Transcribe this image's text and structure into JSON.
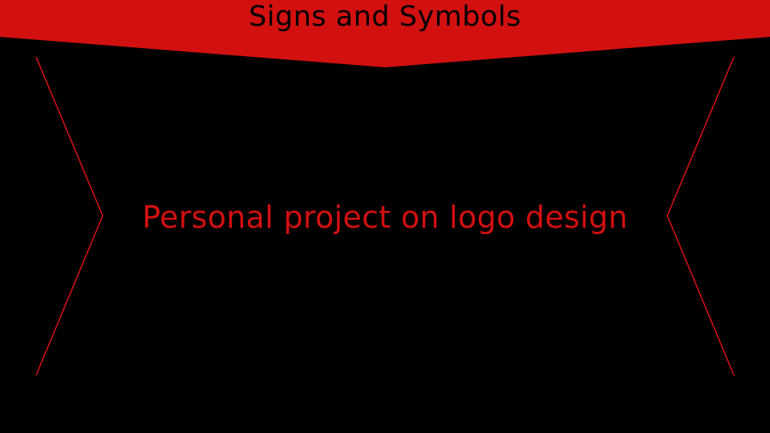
{
  "slide": {
    "title": "Signs and Symbols",
    "subtitle": "Personal project on logo design"
  },
  "colors": {
    "background": "#000000",
    "accent": "#d21010",
    "title_text": "#000000"
  },
  "decorations": {
    "banner": "red-banner-with-pointed-bottom",
    "frame": "red-chevron-line-frame"
  }
}
